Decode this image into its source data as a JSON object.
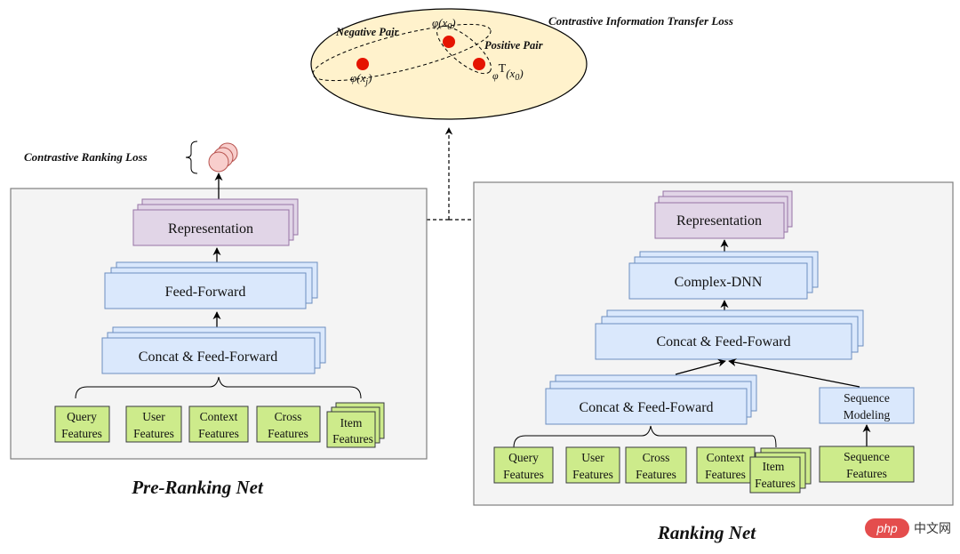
{
  "top": {
    "title": "Contrastive Information Transfer Loss",
    "negative_pair": "Negative Pair",
    "positive_pair": "Positive Pair",
    "phi_x0": "φ(x",
    "phi_x0_sub": "0",
    "phi_xj": "φ(x",
    "phi_xj_sub": "j",
    "phiT": "φ",
    "phiT_sup": "T",
    "phiT_arg": "(x",
    "phiT_sub": "0"
  },
  "pre_ranking": {
    "loss_label": "Contrastive Ranking Loss",
    "representation": "Representation",
    "feed_forward": "Feed-Forward",
    "concat_ff": "Concat & Feed-Forward",
    "features": [
      {
        "line1": "Query",
        "line2": "Features"
      },
      {
        "line1": "User",
        "line2": "Features"
      },
      {
        "line1": "Context",
        "line2": "Features"
      },
      {
        "line1": "Cross",
        "line2": "Features"
      },
      {
        "line1": "Item",
        "line2": "Features"
      }
    ],
    "title": "Pre-Ranking Net"
  },
  "ranking": {
    "representation": "Representation",
    "complex_dnn": "Complex-DNN",
    "concat_ff_top": "Concat & Feed-Foward",
    "concat_ff_bottom": "Concat & Feed-Foward",
    "sequence_modeling": {
      "line1": "Sequence",
      "line2": "Modeling"
    },
    "features": [
      {
        "line1": "Query",
        "line2": "Features"
      },
      {
        "line1": "User",
        "line2": "Features"
      },
      {
        "line1": "Cross",
        "line2": "Features"
      },
      {
        "line1": "Context",
        "line2": "Features"
      },
      {
        "line1": "Item",
        "line2": "Features"
      }
    ],
    "sequence_features": {
      "line1": "Sequence",
      "line2": "Features"
    },
    "title": "Ranking Net"
  },
  "watermark": {
    "brand": "php",
    "suffix": "中文网"
  },
  "colors": {
    "panel_bg": "#f4f4f4",
    "panel_border": "#7f7f7f",
    "purple_fill": "#e1d5e7",
    "purple_border": "#9673a6",
    "blue_fill": "#dae8fc",
    "blue_border": "#6c8ebf",
    "green_fill": "#cdeb8b",
    "green_border": "#36393d",
    "ellipse_fill": "#fff2cc",
    "red_dot": "#e51400",
    "pink_fill": "#f8cecc",
    "pink_border": "#b85450"
  }
}
